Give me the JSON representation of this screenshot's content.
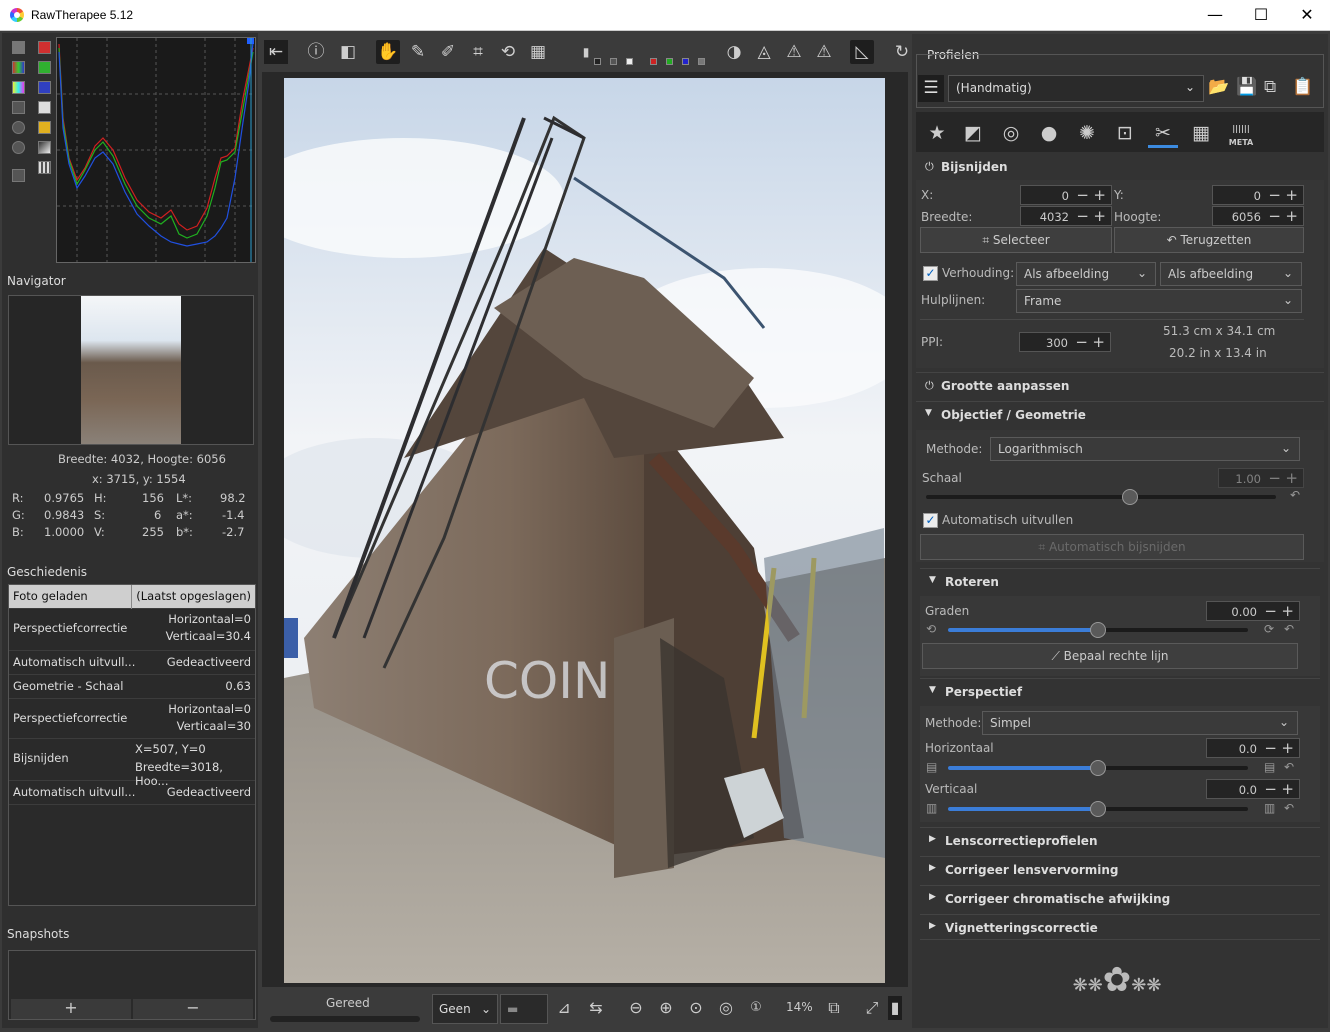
{
  "window": {
    "title": "RawTherapee 5.12",
    "minimize": "—",
    "maximize": "☐",
    "close": "✕"
  },
  "left": {
    "navigator_label": "Navigator",
    "image_size": "Breedte: 4032, Hoogte: 6056",
    "cursor_pos": "x: 3715, y: 1554",
    "values": {
      "r_label": "R:",
      "r": "0.9765",
      "g_label": "G:",
      "g": "0.9843",
      "b_label": "B:",
      "b": "1.0000",
      "h_label": "H:",
      "h": "156",
      "s_label": "S:",
      "s": "6",
      "v_label": "V:",
      "v": "255",
      "l_label": "L*:",
      "l": "98.2",
      "a_label": "a*:",
      "a": "-1.4",
      "bb_label": "b*:",
      "bb": "-2.7"
    },
    "history_label": "Geschiedenis",
    "history": [
      {
        "action": "Foto geladen",
        "detail": "(Laatst opgeslagen)"
      },
      {
        "action": "Perspectiefcorrectie",
        "detail": "Horizontaal=0",
        "detail2": "Verticaal=30.4"
      },
      {
        "action": "Automatisch uitvull...",
        "detail": "Gedeactiveerd"
      },
      {
        "action": "Geometrie - Schaal",
        "detail": "0.63"
      },
      {
        "action": "Perspectiefcorrectie",
        "detail": "Horizontaal=0",
        "detail2": "Verticaal=30"
      },
      {
        "action": "Bijsnijden",
        "detail": "X=507, Y=0",
        "detail2": "Breedte=3018, Hoo..."
      },
      {
        "action": "Automatisch uitvull...",
        "detail": "Gedeactiveerd"
      }
    ],
    "snapshots_label": "Snapshots",
    "snap_add": "+",
    "snap_remove": "−"
  },
  "bottom": {
    "status": "Gereed",
    "interp": "Geen",
    "zoom": "14%"
  },
  "right": {
    "profiles_label": "Profielen",
    "profile_value": "(Handmatig)",
    "crop": {
      "title": "Bijsnijden",
      "x_label": "X:",
      "x": "0",
      "y_label": "Y:",
      "y": "0",
      "w_label": "Breedte:",
      "w": "4032",
      "h_label": "Hoogte:",
      "h": "6056",
      "select_btn": "Selecteer",
      "reset_btn": "Terugzetten",
      "ratio_label": "Verhouding:",
      "ratio1": "Als afbeelding",
      "ratio2": "Als afbeelding",
      "guides_label": "Hulplijnen:",
      "guides": "Frame",
      "ppi_label": "PPI:",
      "ppi": "300",
      "size_cm": "51.3 cm x 34.1 cm",
      "size_in": "20.2 in x 13.4 in"
    },
    "resize_title": "Grootte aanpassen",
    "lens_title": "Objectief / Geometrie",
    "geom": {
      "method_label": "Methode:",
      "method": "Logarithmisch",
      "scale_label": "Schaal",
      "scale": "1.00",
      "autofill_label": "Automatisch uitvullen",
      "autocrop_btn": "Automatisch bijsnijden"
    },
    "rotate": {
      "title": "Roteren",
      "degrees_label": "Graden",
      "degrees": "0.00",
      "straighten_btn": "Bepaal rechte lijn"
    },
    "perspective": {
      "title": "Perspectief",
      "method_label": "Methode:",
      "method": "Simpel",
      "h_label": "Horizontaal",
      "h": "0.0",
      "v_label": "Verticaal",
      "v": "0.0"
    },
    "collapsed": [
      "Lenscorrectieprofielen",
      "Corrigeer lensvervorming",
      "Corrigeer chromatische afwijking",
      "Vignetteringscorrectie"
    ],
    "tab_meta": "META"
  }
}
